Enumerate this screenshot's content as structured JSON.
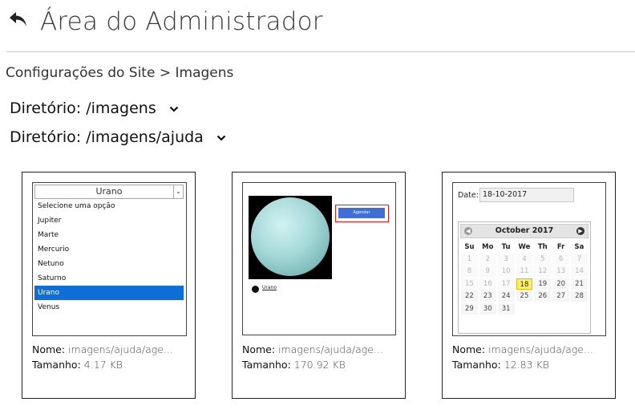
{
  "header": {
    "title": "Área do Administrador",
    "back_icon": "back-arrow-icon"
  },
  "breadcrumb": {
    "parent": "Configurações do Site",
    "separator": ">",
    "current": "Imagens"
  },
  "directories": [
    {
      "label": "Diretório: /imagens"
    },
    {
      "label": "Diretório: /imagens/ajuda"
    }
  ],
  "cards": [
    {
      "name_label": "Nome:",
      "name_value": "imagens/ajuda/age...",
      "size_label": "Tamanho:",
      "size_value": "4.17 KB",
      "preview": {
        "select_value": "Urano",
        "options": [
          "Selecione uma opção",
          "Jupiter",
          "Marte",
          "Mercurio",
          "Netuno",
          "Saturno",
          "Urano",
          "Venus"
        ],
        "selected_index": 6
      }
    },
    {
      "name_label": "Nome:",
      "name_value": "imagens/ajuda/age...",
      "size_label": "Tamanho:",
      "size_value": "170.92 KB",
      "preview": {
        "button_label": "Agendar",
        "link_label": "Urano"
      }
    },
    {
      "name_label": "Nome:",
      "name_value": "imagens/ajuda/age...",
      "size_label": "Tamanho:",
      "size_value": "12.83 KB",
      "preview": {
        "date_label": "Date:",
        "date_value": "18-10-2017",
        "month": "October 2017",
        "days_of_week": [
          "Su",
          "Mo",
          "Tu",
          "We",
          "Th",
          "Fr",
          "Sa"
        ],
        "weeks": [
          [
            "1",
            "2",
            "3",
            "4",
            "5",
            "6",
            "7"
          ],
          [
            "8",
            "9",
            "10",
            "11",
            "12",
            "13",
            "14"
          ],
          [
            "15",
            "16",
            "17",
            "18",
            "19",
            "20",
            "21"
          ],
          [
            "22",
            "23",
            "24",
            "25",
            "26",
            "27",
            "28"
          ],
          [
            "29",
            "30",
            "31",
            "",
            "",
            "",
            ""
          ]
        ],
        "disabled_until": 17,
        "selected_day": "18"
      }
    }
  ],
  "colors": {
    "selected_option": "#0d6fd6",
    "calendar_highlight": "#fdf06a",
    "button_blue": "#3f6ed9",
    "highlight_border": "#d02020"
  }
}
